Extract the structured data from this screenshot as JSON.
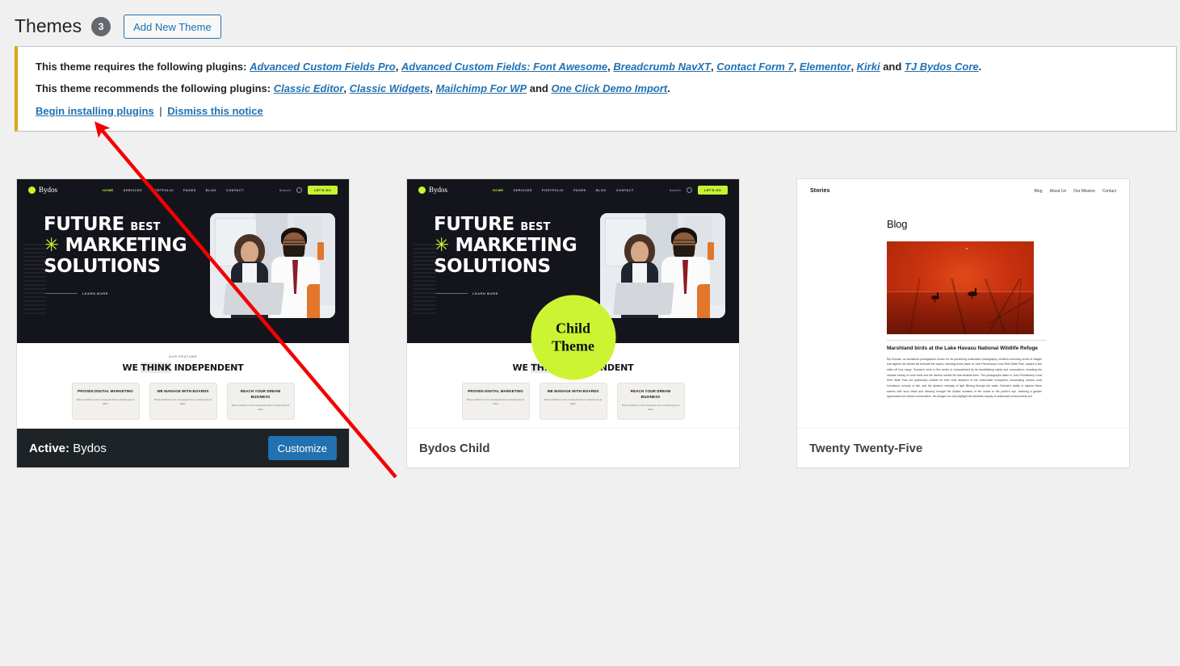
{
  "header": {
    "title": "Themes",
    "count": "3",
    "add_new_label": "Add New Theme"
  },
  "notice": {
    "required_prefix": "This theme requires the following plugins:",
    "required_plugins": [
      "Advanced Custom Fields Pro",
      "Advanced Custom Fields: Font Awesome",
      "Breadcrumb NavXT",
      "Contact Form 7",
      "Elementor",
      "Kirki",
      "TJ Bydos Core"
    ],
    "recommended_prefix": "This theme recommends the following plugins:",
    "recommended_plugins": [
      "Classic Editor",
      "Classic Widgets",
      "Mailchimp For WP",
      "One Click Demo Import"
    ],
    "conjunction": "and",
    "comma": ",",
    "period": ".",
    "begin_install_label": "Begin installing plugins",
    "separator": "|",
    "dismiss_label": "Dismiss this notice",
    "accent_color": "#dba617"
  },
  "themes": [
    {
      "name": "Bydos",
      "active_label": "Active:",
      "is_active": true,
      "customize_label": "Customize",
      "is_child": false
    },
    {
      "name": "Bydos Child",
      "is_active": false,
      "is_child": true,
      "child_badge_line1": "Child",
      "child_badge_line2": "Theme"
    },
    {
      "name": "Twenty Twenty-Five",
      "is_active": false,
      "is_child": false
    }
  ],
  "bydos_preview": {
    "logo_text": "Bydos",
    "menu": [
      "HOME",
      "SERVICES",
      "PORTFOLIO",
      "PAGES",
      "BLOG",
      "CONTACT"
    ],
    "search_label": "Search",
    "cta_label": "LET'S GO",
    "headline_line1": "FUTURE",
    "headline_best": "BEST",
    "headline_line2": "MARKETING",
    "headline_line3": "SOLUTIONS",
    "learn_more_label": "LEARN MORE",
    "section_tag": "OUR FEATURE",
    "section_title_a": "WE",
    "section_title_b": "THINK",
    "section_title_c": "INDEPENDENT",
    "feature_cards": [
      {
        "title": "PROVEN DIGITAL MARKETING",
        "desc": "Risus tincidunt in the consequat lorem suscipit quis at ullam"
      },
      {
        "title": "WE MANAGE WITH BOARDS",
        "desc": "Risus tincidunt in the consequat lorem suscipit quis at ullam"
      },
      {
        "title": "REACH YOUR DREAM BUSINESS",
        "desc": "Risus tincidunt in the consequat lorem suscipit quis at ullam"
      }
    ],
    "accent_color": "#c6f432"
  },
  "tt5_preview": {
    "brand": "Stories",
    "links": [
      "Blog",
      "About Us",
      "Our Mission",
      "Contact"
    ],
    "page_title": "Blog",
    "post_title": "Marshland birds at the Lake Havasu National Wildlife Refuge",
    "post_body": "Rip Schulze, an acclaimed photographer known for his pioneering underwater photography, created a stunning series of images that capture the vibrant life beneath the waves, including those taken at John Pennekamp Coral Reef State Park, located a few miles off Key Largo. Schulze's work in this series is characterized by its breathtaking clarity and composition, revealing the intricate beauty of coral reefs and the diverse marine life that inhabits them. The photographs taken in John Pennekamp Coral Reef State Park are particularly notable for their vivid depiction of the underwater ecosystem, showcasing colorful coral formations, schools of fish, and the dynamic interplay of light filtering through the water. Schulze's ability to capture these scenes with such detail and vibrancy brought the hidden wonders of the ocean to the public's eye, fostering a greater appreciation for marine conservation. His images not only highlight the aesthetic beauty of underwater environments but"
  },
  "annotation": {
    "arrow_color": "#f50000"
  }
}
